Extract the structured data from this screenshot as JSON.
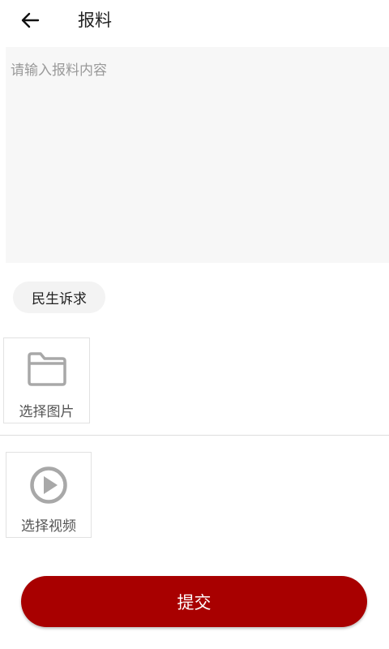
{
  "header": {
    "title": "报料",
    "back_icon": "arrow-left-icon"
  },
  "content_input": {
    "placeholder": "请输入报料内容",
    "value": ""
  },
  "category": {
    "label": "民生诉求"
  },
  "image_picker": {
    "label": "选择图片",
    "icon": "folder-icon"
  },
  "video_picker": {
    "label": "选择视频",
    "icon": "play-circle-icon"
  },
  "submit": {
    "label": "提交"
  },
  "colors": {
    "accent": "#a80000",
    "input_bg": "#f7f7f7",
    "icon_gray": "#a8a8a8"
  }
}
